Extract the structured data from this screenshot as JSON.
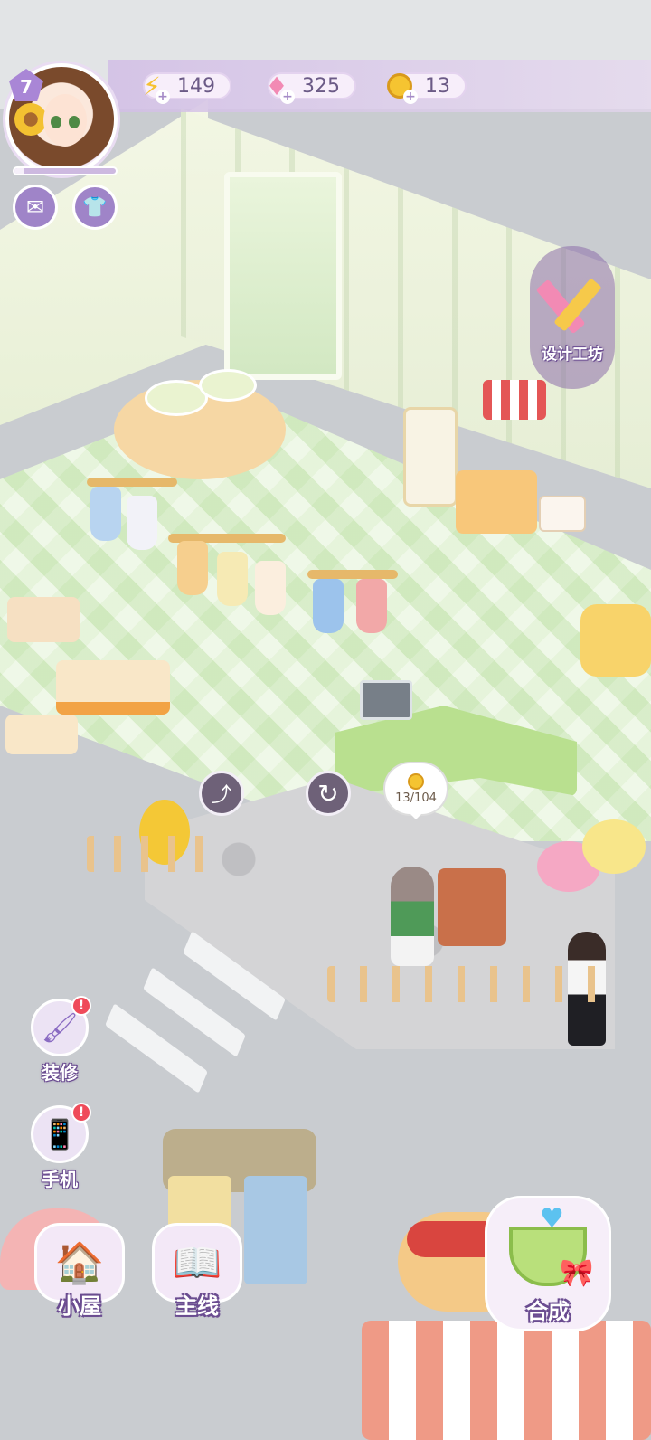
{
  "player": {
    "level": "7",
    "xp_progress": 0.1
  },
  "resources": {
    "energy": "149",
    "gems": "325",
    "coins": "13"
  },
  "buttons": {
    "design_workshop": "设计工坊",
    "decorate": "装修",
    "phone": "手机",
    "cottage": "小屋",
    "main_story": "主线",
    "merge": "合成"
  },
  "shop_counter": "13/104",
  "icons": {
    "energy": "lightning-icon",
    "gems": "gem-icon",
    "coins": "coin-icon",
    "mail": "mail-icon",
    "outfit": "outfit-icon",
    "design": "pencil-ruler-icon",
    "store": "store-icon",
    "rotate": "rotate-icon",
    "decorate": "brush-icon",
    "phone": "phone-icon",
    "cottage": "house-icon",
    "main_story": "book-icon",
    "merge": "teacup-icon"
  },
  "colors": {
    "accent": "#a986d6",
    "badge": "#ef4b5a",
    "coin": "#f5c431",
    "gem": "#f28ab4"
  }
}
